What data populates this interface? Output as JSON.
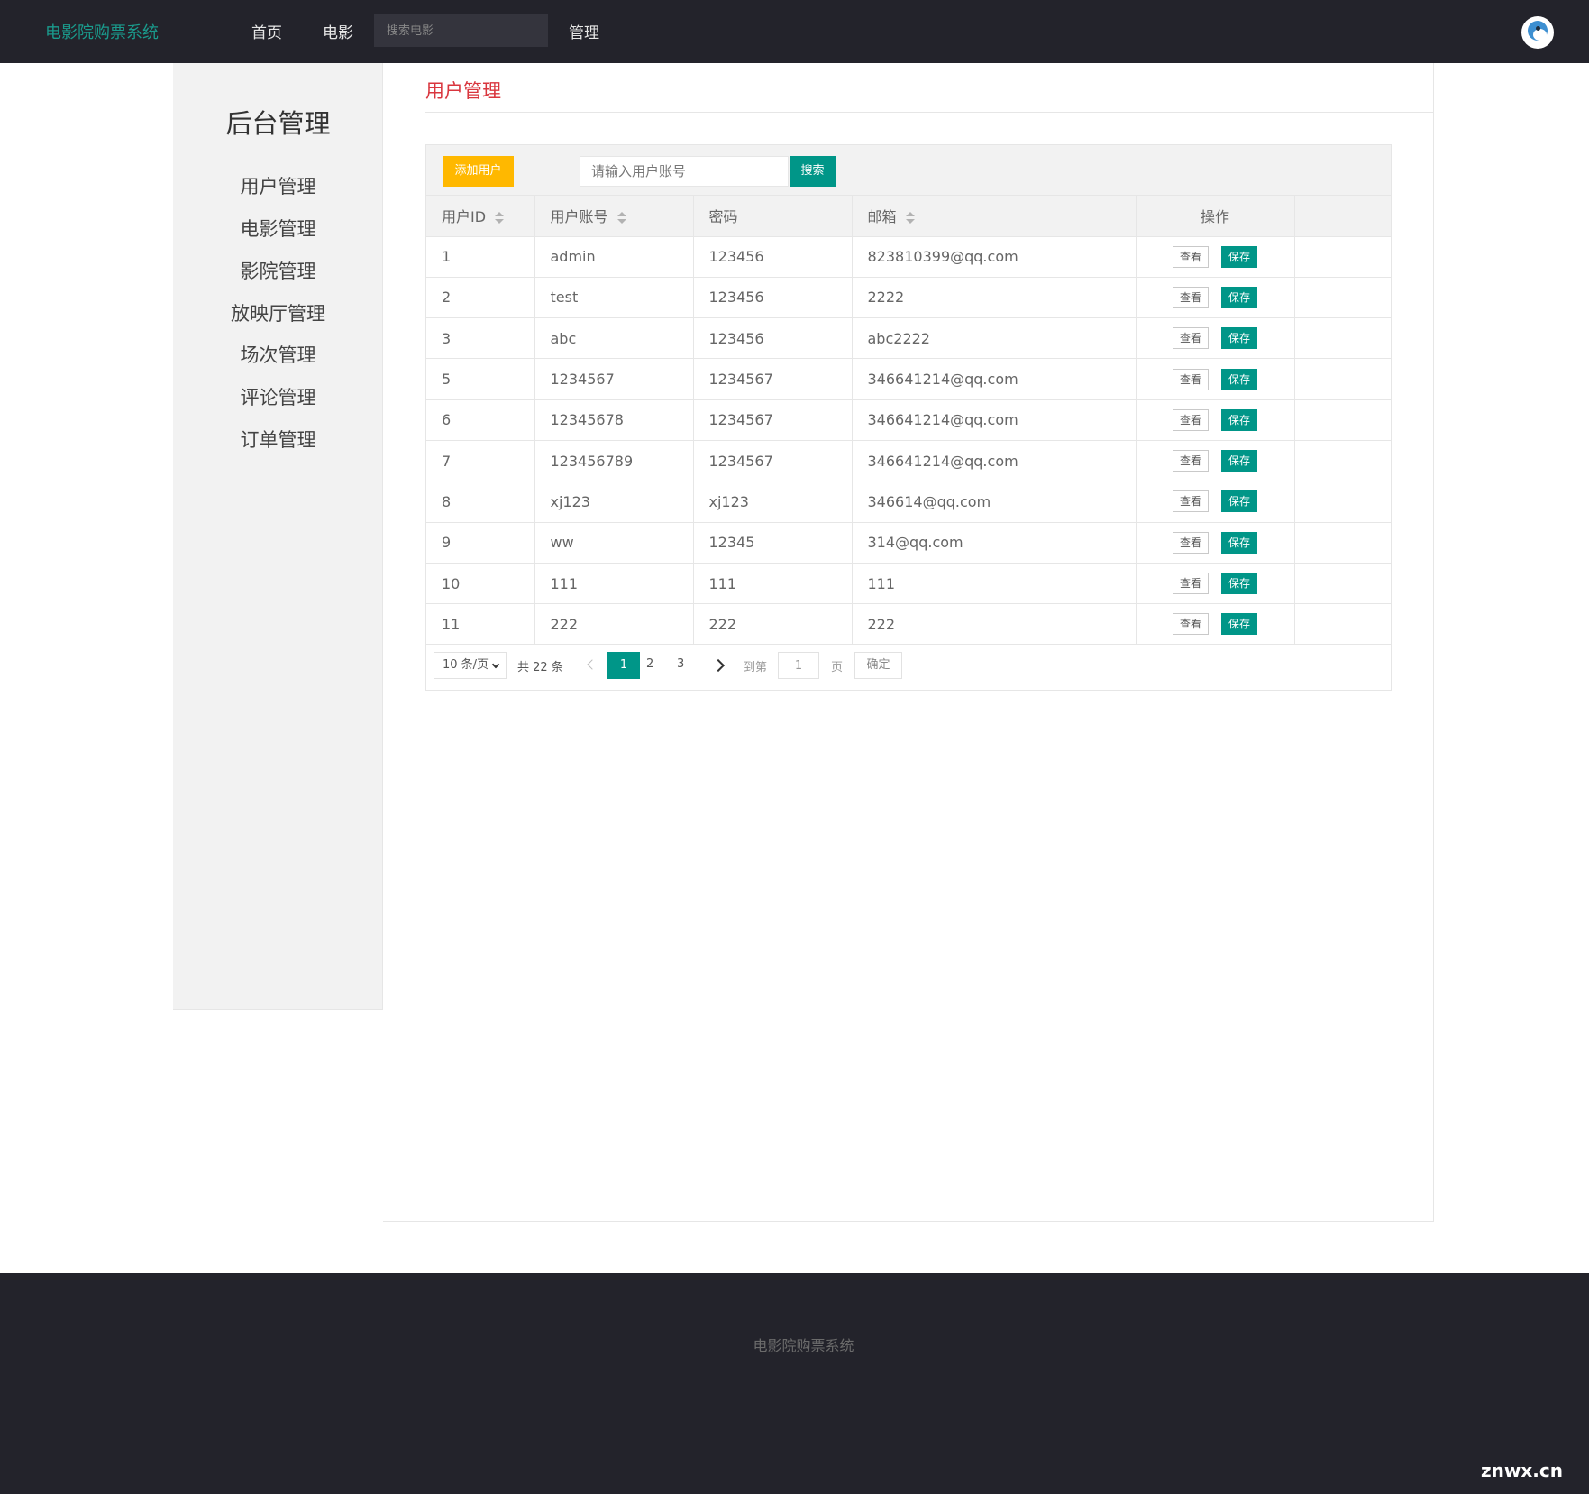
{
  "nav": {
    "brand": "电影院购票系统",
    "home": "首页",
    "movies": "电影",
    "search_placeholder": "搜索电影",
    "admin": "管理"
  },
  "sidebar": {
    "title": "后台管理",
    "items": [
      {
        "label": "用户管理"
      },
      {
        "label": "电影管理"
      },
      {
        "label": "影院管理"
      },
      {
        "label": "放映厅管理"
      },
      {
        "label": "场次管理"
      },
      {
        "label": "评论管理"
      },
      {
        "label": "订单管理"
      }
    ]
  },
  "main": {
    "title": "用户管理",
    "add_button": "添加用户",
    "search_placeholder": "请输入用户账号",
    "search_button": "搜索",
    "columns": {
      "id": "用户ID",
      "account": "用户账号",
      "password": "密码",
      "email": "邮箱",
      "actions": "操作"
    },
    "view_label": "查看",
    "save_label": "保存",
    "rows": [
      {
        "id": "1",
        "account": "admin",
        "password": "123456",
        "email": "823810399@qq.com"
      },
      {
        "id": "2",
        "account": "test",
        "password": "123456",
        "email": "2222"
      },
      {
        "id": "3",
        "account": "abc",
        "password": "123456",
        "email": "abc2222"
      },
      {
        "id": "5",
        "account": "1234567",
        "password": "1234567",
        "email": "346641214@qq.com"
      },
      {
        "id": "6",
        "account": "12345678",
        "password": "1234567",
        "email": "346641214@qq.com"
      },
      {
        "id": "7",
        "account": "123456789",
        "password": "1234567",
        "email": "346641214@qq.com"
      },
      {
        "id": "8",
        "account": "xj123",
        "password": "xj123",
        "email": "346614@qq.com"
      },
      {
        "id": "9",
        "account": "ww",
        "password": "12345",
        "email": "314@qq.com"
      },
      {
        "id": "10",
        "account": "111",
        "password": "111",
        "email": "111"
      },
      {
        "id": "11",
        "account": "222",
        "password": "222",
        "email": "222"
      }
    ]
  },
  "pager": {
    "page_size": "10 条/页",
    "total": "共 22 条",
    "current": "1",
    "pages": [
      "2",
      "3"
    ],
    "goto_label": "到第",
    "goto_value": "1",
    "page_unit": "页",
    "confirm": "确定"
  },
  "footer": {
    "text": "电影院购票系统",
    "watermark": "znwx.cn"
  },
  "colors": {
    "nav_bg": "#23232b",
    "brand": "#1a9a8c",
    "accent": "#009688",
    "add_button": "#ffb800",
    "page_title": "#d9363e"
  }
}
